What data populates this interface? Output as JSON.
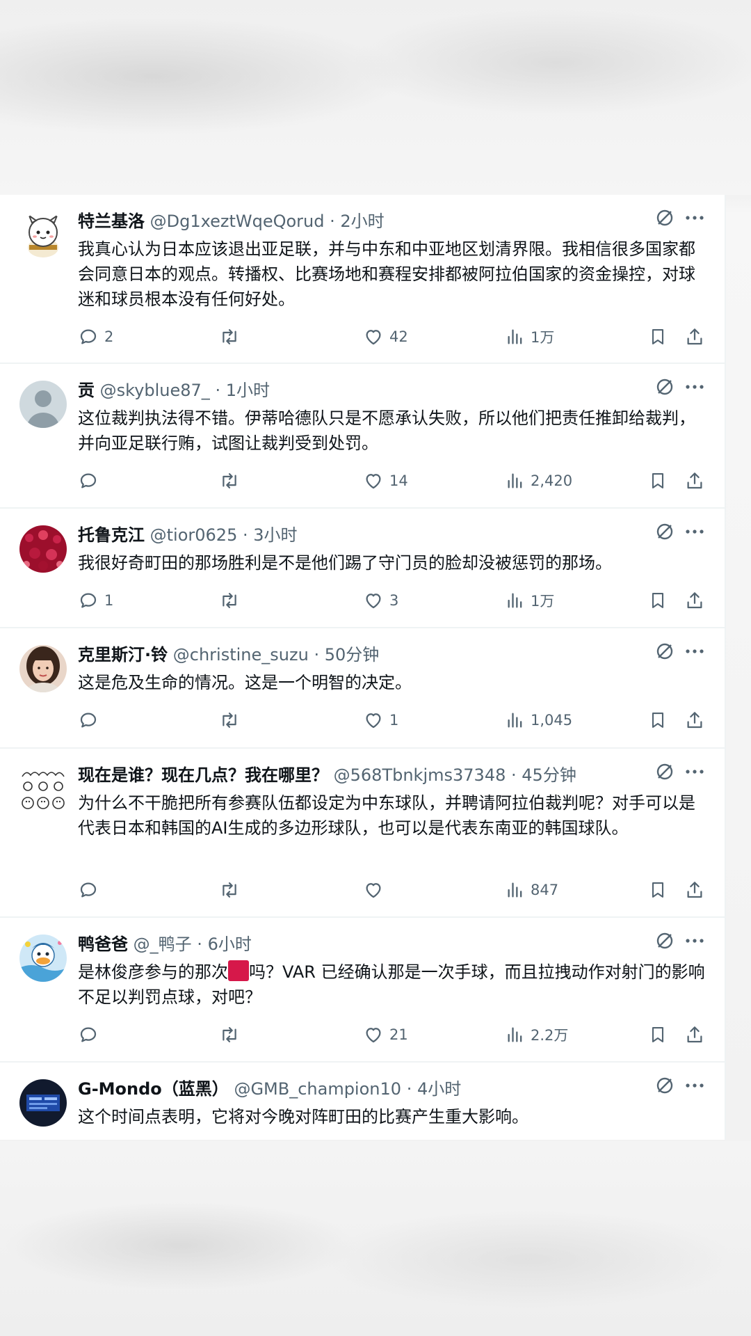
{
  "tweets": [
    {
      "name": "特兰基洛",
      "handle": "@Dg1xeztWqeQorud",
      "separator": "·",
      "time": "2小时",
      "text": "我真心认为日本应该退出亚足联，并与中东和中亚地区划清界限。我相信很多国家都会同意日本的观点。转播权、比赛场地和赛程安排都被阿拉伯国家的资金操控，对球迷和球员根本没有任何好处。",
      "replies": "2",
      "retweets": "",
      "likes": "42",
      "views": "1万",
      "avatar": "chiikawa-character-avatar"
    },
    {
      "name": "贡",
      "handle": "@skyblue87_",
      "separator": "·",
      "time": "1小时",
      "text": "这位裁判执法得不错。伊蒂哈德队只是不愿承认失败，所以他们把责任推卸给裁判，并向亚足联行贿，试图让裁判受到处罚。",
      "replies": "",
      "retweets": "",
      "likes": "14",
      "views": "2,420",
      "avatar": "default-person-avatar"
    },
    {
      "name": "托鲁克江",
      "handle": "@tior0625",
      "separator": "·",
      "time": "3小时",
      "text": "我很好奇町田的那场胜利是不是他们踢了守门员的脸却没被惩罚的那场。",
      "replies": "1",
      "retweets": "",
      "likes": "3",
      "views": "1万",
      "avatar": "red-crowd-avatar"
    },
    {
      "name": "克里斯汀·铃",
      "handle": "@christine_suzu",
      "separator": "·",
      "time": "50分钟",
      "text": "这是危及生命的情况。这是一个明智的决定。",
      "replies": "",
      "retweets": "",
      "likes": "1",
      "views": "1,045",
      "avatar": "woman-portrait-avatar"
    },
    {
      "name": "现在是谁？现在几点？我在哪里？",
      "handle": "@568Tbnkjms37348",
      "separator": "·",
      "time": "45分钟",
      "text": "为什么不干脆把所有参赛队伍都设定为中东球队，并聘请阿拉伯裁判呢？对手可以是代表日本和韩国的AI生成的多边形球队，也可以是代表东南亚的韩国球队。",
      "replies": "",
      "retweets": "",
      "likes": "",
      "views": "847",
      "avatar": "doodle-characters-avatar"
    },
    {
      "name": "鸭爸爸",
      "handle": "@_鸭子",
      "separator": "·",
      "time": "6小时",
      "text_before": "是林俊彦参与的那次",
      "text_after": "吗？VAR 已经确认那是一次手球，而且拉拽动作对射门的影响不足以判罚点球，对吧？",
      "replies": "",
      "retweets": "",
      "likes": "21",
      "views": "2.2万",
      "avatar": "cartoon-duck-avatar"
    },
    {
      "name": "G-Mondo（蓝黑）",
      "handle": "@GMB_champion10",
      "separator": "·",
      "time": "4小时",
      "text": "这个时间点表明，它将对今晚对阵町田的比赛产生重大影响。",
      "avatar": "scoreboard-avatar"
    }
  ],
  "colors": {
    "text_primary": "#0f1419",
    "text_secondary": "#536471",
    "divider": "#eff3f4",
    "redaction": "#d6184a"
  }
}
